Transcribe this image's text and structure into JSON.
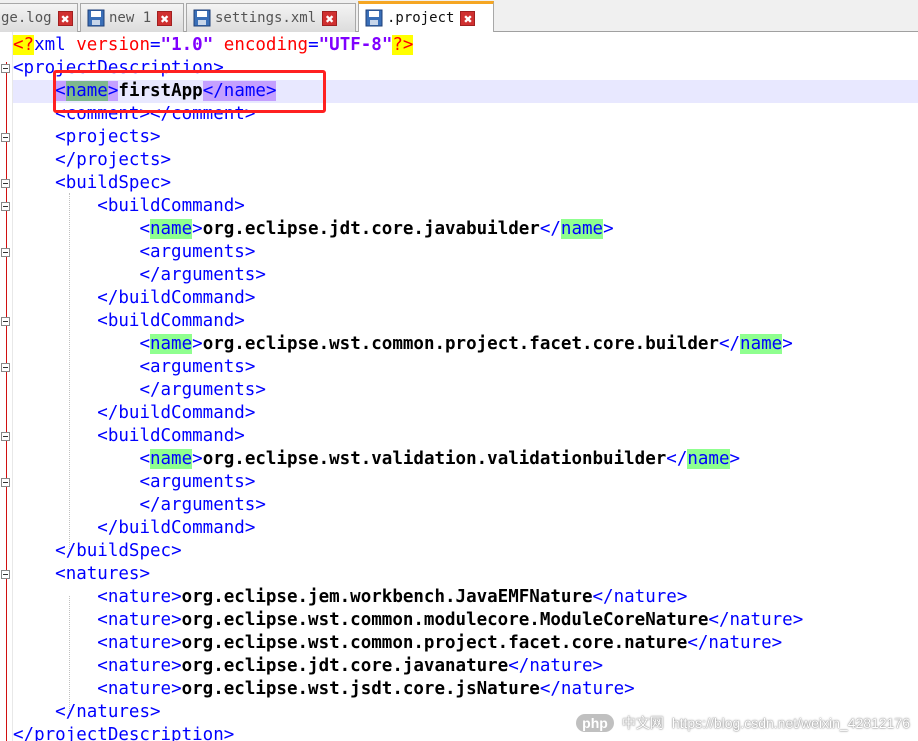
{
  "tabs": [
    {
      "label": "ge.log",
      "icon": "none"
    },
    {
      "label": "new 1",
      "icon": "save-disk-icon"
    },
    {
      "label": "settings.xml",
      "icon": "save-disk-icon"
    },
    {
      "label": ".project",
      "icon": "save-disk-icon",
      "active": true
    }
  ],
  "tab_close_glyph": "✖",
  "xml": {
    "pi_open": "<?",
    "pi_name": "xml",
    "attr_version": "version",
    "val_version": "\"1.0\"",
    "attr_encoding": "encoding",
    "val_encoding": "\"UTF-8\"",
    "pi_close": "?>",
    "root": "projectDescription",
    "name_tag": "name",
    "project_name": "firstApp",
    "comment_tag": "comment",
    "projects_tag": "projects",
    "buildspec_tag": "buildSpec",
    "buildcommand_tag": "buildCommand",
    "arguments_tag": "arguments",
    "natures_tag": "natures",
    "nature_tag": "nature",
    "builders": [
      "org.eclipse.jdt.core.javabuilder",
      "org.eclipse.wst.common.project.facet.core.builder",
      "org.eclipse.wst.validation.validationbuilder"
    ],
    "natures": [
      "org.eclipse.jem.workbench.JavaEMFNature",
      "org.eclipse.wst.common.modulecore.ModuleCoreNature",
      "org.eclipse.wst.common.project.facet.core.nature",
      "org.eclipse.jdt.core.javanature",
      "org.eclipse.wst.jsdt.core.jsNature"
    ]
  },
  "watermark": {
    "logo": "php",
    "logo_suffix": "中文网",
    "url": "https://blog.csdn.net/weixin_42812176"
  },
  "colors": {
    "tag": "#0000ff",
    "text": "#000000",
    "attr": "#ff0000",
    "value": "#8000ff",
    "highlight_match": "#8fff8f",
    "current_line": "#e8e8ff",
    "annotation_box": "#ff2020",
    "active_tab_accent": "#f5a623"
  }
}
